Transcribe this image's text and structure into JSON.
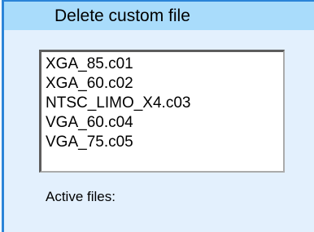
{
  "dialog": {
    "title": "Delete custom file",
    "files": [
      "XGA_85.c01",
      "XGA_60.c02",
      "NTSC_LIMO_X4.c03",
      "VGA_60.c04",
      "VGA_75.c05"
    ],
    "active_files_label": "Active files:"
  },
  "colors": {
    "title_bar": "#a9dcfb",
    "panel_background": "#e3f0fd",
    "panel_border": "#2b84d8"
  }
}
